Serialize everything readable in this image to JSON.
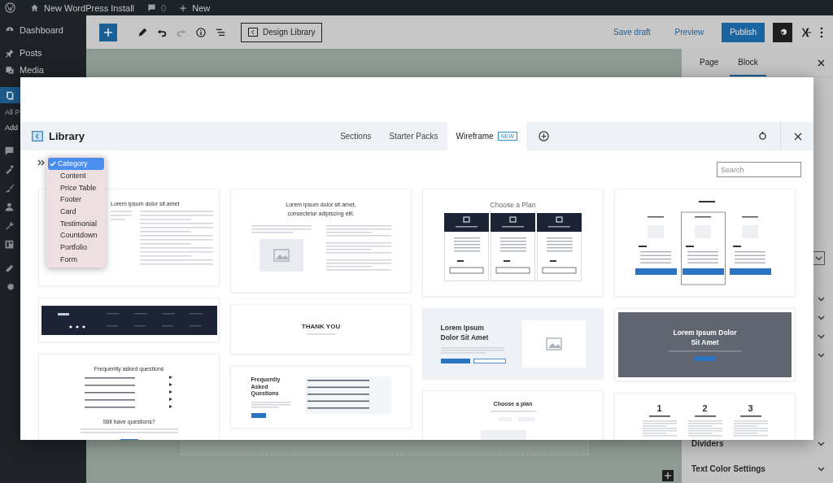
{
  "admin_bar": {
    "site_title": "New WordPress Install",
    "comments_count": "0",
    "new_label": "New"
  },
  "admin_menu": {
    "items": [
      {
        "label": "Dashboard",
        "selected": false
      },
      {
        "label": "Posts",
        "selected": false
      },
      {
        "label": "Media",
        "selected": false
      }
    ],
    "pages_item": {
      "selected": true
    },
    "submenu": [
      "All P",
      "Add"
    ]
  },
  "toolbar": {
    "library_button": "Design Library",
    "save_draft": "Save draft",
    "preview": "Preview",
    "publish": "Publish"
  },
  "settings_sidebar": {
    "tabs": [
      {
        "label": "Page",
        "selected": false
      },
      {
        "label": "Block",
        "selected": true
      }
    ],
    "panels": [
      {
        "title": "Dividers"
      },
      {
        "title": "Text Color Settings"
      }
    ]
  },
  "library": {
    "title": "Library",
    "tabs": [
      {
        "label": "Sections",
        "selected": false
      },
      {
        "label": "Starter Packs",
        "selected": false
      },
      {
        "label": "Wireframe",
        "badge": "NEW",
        "selected": true
      }
    ],
    "search": {
      "placeholder": "Search"
    },
    "category_menu": {
      "options": [
        {
          "label": "Category",
          "selected": true
        },
        {
          "label": "Content",
          "selected": false
        },
        {
          "label": "Price Table",
          "selected": false
        },
        {
          "label": "Footer",
          "selected": false
        },
        {
          "label": "Card",
          "selected": false
        },
        {
          "label": "Testimonial",
          "selected": false
        },
        {
          "label": "Countdown",
          "selected": false
        },
        {
          "label": "Portfolio",
          "selected": false
        },
        {
          "label": "Form",
          "selected": false
        }
      ]
    },
    "columns": [
      {
        "cards": [
          {
            "kind": "text-columns",
            "heading": "Lorem ipsum dolor sit amet"
          },
          {
            "kind": "dark-header"
          },
          {
            "kind": "faq-list",
            "heading": "Frequently asked questions",
            "subheading": "Still have questions?"
          }
        ]
      },
      {
        "cards": [
          {
            "kind": "image-text",
            "heading": "Lorem ipsum dolor sit amet, consectetur adipiscing elit."
          },
          {
            "kind": "thank-you",
            "heading": "THANK YOU"
          },
          {
            "kind": "faq-side",
            "heading": "Frequently Asked Questions"
          }
        ]
      },
      {
        "cards": [
          {
            "kind": "plan-columns",
            "heading": "Choose a Plan"
          },
          {
            "kind": "hero-light",
            "heading": "Lorem Ipsum Dolor Sit Amet"
          },
          {
            "kind": "plan-tabs",
            "heading": "Choose a plan"
          }
        ]
      },
      {
        "cards": [
          {
            "kind": "pricing-table"
          },
          {
            "kind": "hero-dark",
            "heading": "Lorem Ipsum Dolor Sit Amet"
          },
          {
            "kind": "numbered",
            "numbers": [
              "1",
              "2",
              "3"
            ]
          }
        ]
      }
    ]
  }
}
